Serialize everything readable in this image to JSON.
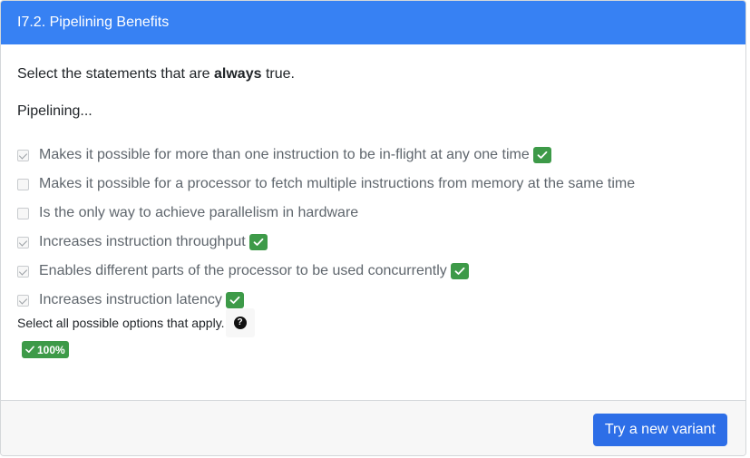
{
  "header": {
    "title": "I7.2. Pipelining Benefits"
  },
  "question": {
    "instruction_prefix": "Select the statements that are ",
    "instruction_emphasis": "always",
    "instruction_suffix": " true.",
    "lead": "Pipelining..."
  },
  "options": [
    {
      "label": "Makes it possible for more than one instruction to be in-flight at any one time",
      "checked": true,
      "marked_correct": true
    },
    {
      "label": "Makes it possible for a processor to fetch multiple instructions from memory at the same time",
      "checked": false,
      "marked_correct": false
    },
    {
      "label": "Is the only way to achieve parallelism in hardware",
      "checked": false,
      "marked_correct": false
    },
    {
      "label": "Increases instruction throughput",
      "checked": true,
      "marked_correct": true
    },
    {
      "label": "Enables different parts of the processor to be used concurrently",
      "checked": true,
      "marked_correct": true
    },
    {
      "label": "Increases instruction latency",
      "checked": true,
      "marked_correct": true
    }
  ],
  "hint": {
    "text": "Select all possible options that apply.",
    "help_symbol": "?"
  },
  "score": {
    "text": "100%"
  },
  "footer": {
    "try_button": "Try a new variant"
  },
  "colors": {
    "header": "#3781f3",
    "correct": "#3d9a48",
    "button": "#2d6ee7"
  }
}
